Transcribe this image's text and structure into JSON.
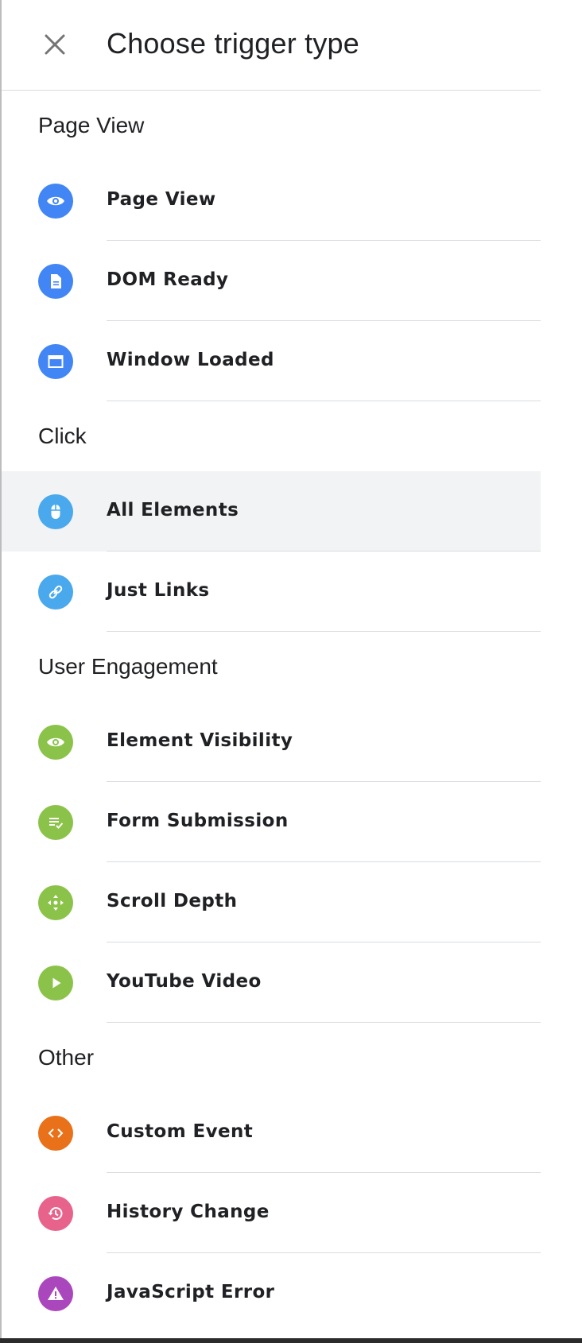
{
  "header": {
    "title": "Choose trigger type",
    "close_icon": "close-icon"
  },
  "sections": [
    {
      "title": "Page View",
      "items": [
        {
          "label": "Page View",
          "icon": "eye-icon",
          "color": "#4285f4"
        },
        {
          "label": "DOM Ready",
          "icon": "document-icon",
          "color": "#4285f4"
        },
        {
          "label": "Window Loaded",
          "icon": "window-icon",
          "color": "#4285f4"
        }
      ]
    },
    {
      "title": "Click",
      "items": [
        {
          "label": "All Elements",
          "icon": "mouse-icon",
          "color": "#4aa8ec"
        },
        {
          "label": "Just Links",
          "icon": "link-icon",
          "color": "#4aa8ec"
        }
      ]
    },
    {
      "title": "User Engagement",
      "items": [
        {
          "label": "Element Visibility",
          "icon": "eye-icon",
          "color": "#8bc34a"
        },
        {
          "label": "Form Submission",
          "icon": "form-check-icon",
          "color": "#8bc34a"
        },
        {
          "label": "Scroll Depth",
          "icon": "move-arrows-icon",
          "color": "#8bc34a"
        },
        {
          "label": "YouTube Video",
          "icon": "play-icon",
          "color": "#8bc34a"
        }
      ]
    },
    {
      "title": "Other",
      "items": [
        {
          "label": "Custom Event",
          "icon": "code-icon",
          "color": "#e8711a"
        },
        {
          "label": "History Change",
          "icon": "history-icon",
          "color": "#e8638b"
        },
        {
          "label": "JavaScript Error",
          "icon": "warning-icon",
          "color": "#ab47bc"
        }
      ]
    }
  ],
  "hovered_item": "All Elements",
  "colors": {
    "separator": "#dadce0",
    "hover_background": "#f1f3f4",
    "text": "#202124"
  }
}
